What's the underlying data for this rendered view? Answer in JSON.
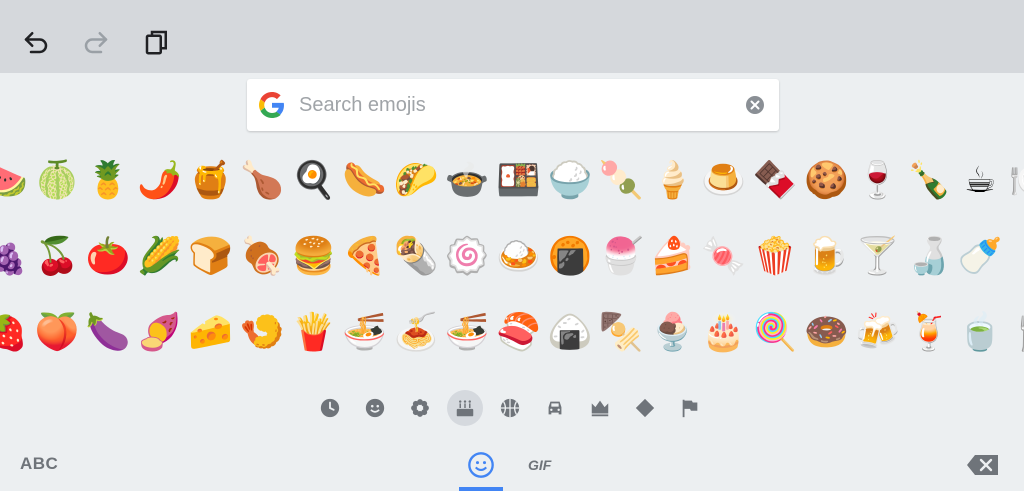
{
  "toolbar": {
    "undo_icon": "undo-icon",
    "redo_icon": "redo-icon",
    "clipboard_icon": "clipboard-icon"
  },
  "search": {
    "placeholder": "Search emojis",
    "value": ""
  },
  "emoji_rows": [
    [
      "🍉",
      "🍈",
      "🍍",
      "🌶️",
      "🍯",
      "🍗",
      "🍳",
      "🌭",
      "🌮",
      "🍲",
      "🍱",
      "🍚",
      "🍡",
      "🍦",
      "🍮",
      "🍫",
      "🍪",
      "🍷",
      "🍾",
      "☕",
      "🍽️"
    ],
    [
      "🍇",
      "🍒",
      "🍅",
      "🌽",
      "🍞",
      "🍖",
      "🍔",
      "🍕",
      "🌯",
      "🍥",
      "🍛",
      "🍘",
      "🍧",
      "🍰",
      "🍬",
      "🍿",
      "🍺",
      "🍸",
      "🍶",
      "🍼"
    ],
    [
      "🍓",
      "🍑",
      "🍆",
      "🍠",
      "🧀",
      "🍤",
      "🍟",
      "🍜",
      "🍝",
      "🍜",
      "🍣",
      "🍙",
      "🍢",
      "🍨",
      "🎂",
      "🍭",
      "🍩",
      "🍻",
      "🍹",
      "🍵",
      "🍴"
    ]
  ],
  "categories": [
    {
      "name": "recent",
      "icon": "clock-icon",
      "active": false
    },
    {
      "name": "smileys",
      "icon": "smiley-icon",
      "active": false
    },
    {
      "name": "nature",
      "icon": "flower-icon",
      "active": false
    },
    {
      "name": "food",
      "icon": "cake-icon",
      "active": true
    },
    {
      "name": "activities",
      "icon": "ball-icon",
      "active": false
    },
    {
      "name": "travel",
      "icon": "car-icon",
      "active": false
    },
    {
      "name": "objects",
      "icon": "crown-icon",
      "active": false
    },
    {
      "name": "symbols",
      "icon": "diamond-icon",
      "active": false
    },
    {
      "name": "flags",
      "icon": "flag-icon",
      "active": false
    }
  ],
  "bottom_bar": {
    "abc_label": "ABC",
    "gif_label": "GIF"
  },
  "colors": {
    "accent": "#4285f4",
    "icon_gray": "#6f747a",
    "background": "#eceff1",
    "top_bar": "#d5d8dc"
  }
}
